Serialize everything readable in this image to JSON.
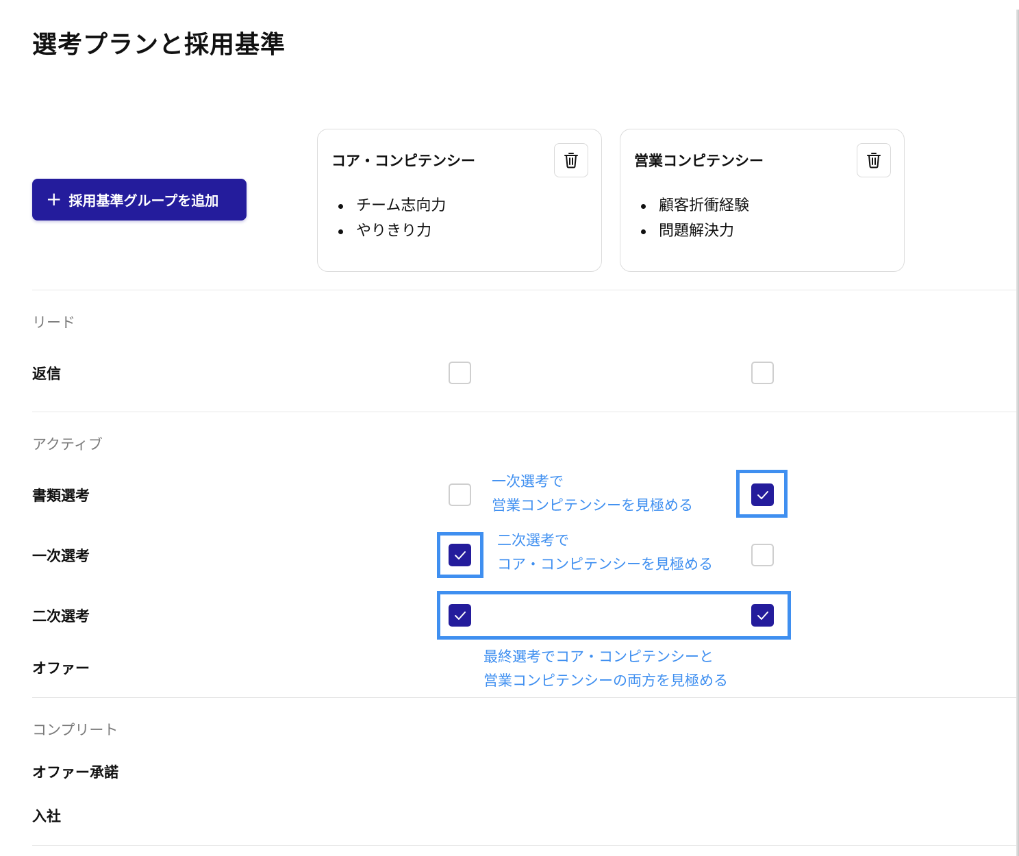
{
  "page": {
    "title": "選考プランと採用基準"
  },
  "toolbar": {
    "add_group_label": "採用基準グループを追加",
    "add_icon": "plus-icon"
  },
  "groups": [
    {
      "title": "コア・コンピテンシー",
      "items": [
        "チーム志向力",
        "やりきり力"
      ],
      "delete_icon": "trash-icon"
    },
    {
      "title": "営業コンピテンシー",
      "items": [
        "顧客折衝経験",
        "問題解決力"
      ],
      "delete_icon": "trash-icon"
    }
  ],
  "sections": [
    {
      "label": "リード",
      "rows": [
        {
          "label": "返信",
          "checks": [
            false,
            false
          ]
        }
      ]
    },
    {
      "label": "アクティブ",
      "rows": [
        {
          "label": "書類選考",
          "checks": [
            false,
            true
          ]
        },
        {
          "label": "一次選考",
          "checks": [
            true,
            false
          ]
        },
        {
          "label": "二次選考",
          "checks": [
            true,
            true
          ]
        },
        {
          "label": "オファー",
          "checks": null
        }
      ]
    },
    {
      "label": "コンプリート",
      "rows": [
        {
          "label": "オファー承諾",
          "checks": null
        },
        {
          "label": "入社",
          "checks": null
        }
      ]
    }
  ],
  "annotations": [
    {
      "lines": [
        "一次選考で",
        "営業コンピテンシーを見極める"
      ]
    },
    {
      "lines": [
        "二次選考で",
        "コア・コンピテンシーを見極める"
      ]
    },
    {
      "lines": [
        "最終選考でコア・コンピテンシーと",
        "営業コンピテンシーの両方を見極める"
      ]
    }
  ],
  "colors": {
    "accent": "#241c9c",
    "annotation": "#3f8ff0",
    "muted_text": "#7b7b7b",
    "border": "#dcdcdc"
  }
}
